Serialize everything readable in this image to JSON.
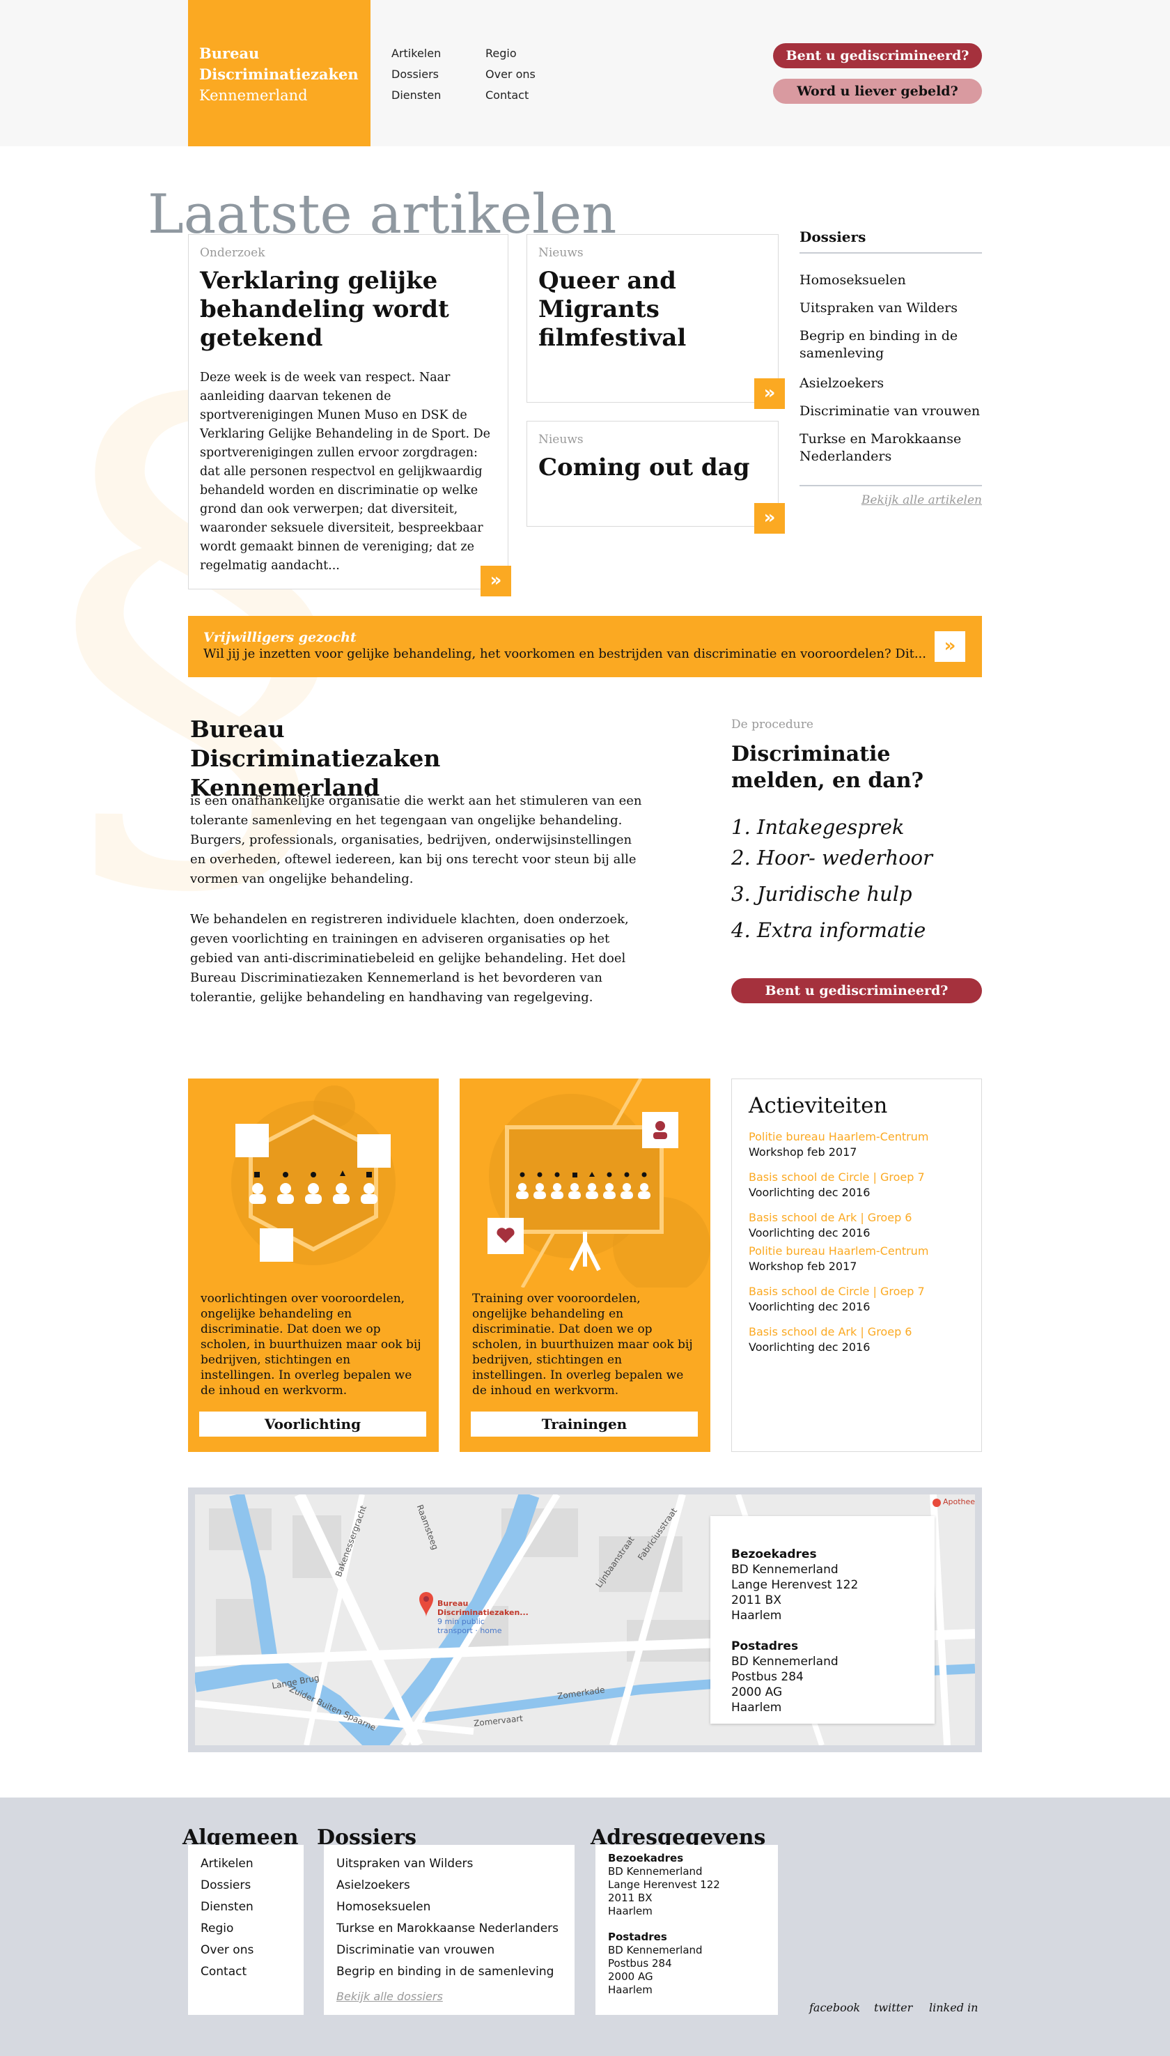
{
  "header": {
    "logo": {
      "line1": "Bureau",
      "line2": "Discriminatiezaken",
      "line3": "Kennemerland"
    },
    "nav_left": [
      "Artikelen",
      "Dossiers",
      "Diensten"
    ],
    "nav_right": [
      "Regio",
      "Over ons",
      "Contact"
    ],
    "cta_primary": "Bent u gediscrimineerd?",
    "cta_secondary": "Word u liever gebeld?"
  },
  "latest": {
    "title": "Laatste artikelen",
    "main_article": {
      "category": "Onderzoek",
      "title": "Verklaring gelijke behandeling wordt getekend",
      "body": "Deze week is de week van respect. Naar aanleiding daarvan tekenen de sportverenigingen Munen Muso en DSK de Verklaring Gelijke Behandeling in de Sport. De sportverenigingen zullen ervoor zorgdragen: dat alle personen respectvol en gelijkwaardig behandeld worden en discriminatie op welke grond dan ook verwerpen; dat diversiteit, waaronder seksuele diversiteit, bespreekbaar wordt gemaakt binnen de vereniging; dat ze regelmatig aandacht..."
    },
    "article2": {
      "category": "Nieuws",
      "title": "Queer and Migrants filmfestival"
    },
    "article3": {
      "category": "Nieuws",
      "title": "Coming out dag"
    },
    "arrow": "»"
  },
  "dossiers": {
    "heading": "Dossiers",
    "items": [
      "Homoseksuelen",
      "Uitspraken van Wilders",
      "Begrip en binding in de samenleving",
      "Asielzoekers",
      "Discriminatie van vrouwen",
      "Turkse en Marokkaanse Nederlanders"
    ],
    "more": "Bekijk alle artikelen"
  },
  "volunteers": {
    "title": "Vrijwilligers gezocht",
    "text": "Wil jij je inzetten voor gelijke behandeling, het voorkomen en bestrijden van discriminatie en vooroordelen? Dit...",
    "arrow": "»"
  },
  "about": {
    "heading": "Bureau Discriminatiezaken Kennemerland",
    "p1": "is een onafhankelijke organisatie die werkt aan het stimuleren van een tolerante samenleving en het tegengaan van ongelijke behandeling. Burgers, professionals, organisaties, bedrijven, onderwijsinstellingen en overheden, oftewel iedereen, kan bij ons terecht voor steun bij alle vormen van ongelijke behandeling.",
    "p2": "We behandelen en registreren individuele klachten, doen onderzoek, geven voorlichting en trainingen en adviseren organisaties op het gebied van anti-discriminatiebeleid en gelijke behandeling. Het doel Bureau Discriminatiezaken Kennemerland is het bevorderen van tolerantie, gelijke behandeling en handhaving van regelgeving."
  },
  "procedure": {
    "category": "De procedure",
    "heading": "Discriminatie melden, en dan?",
    "steps": [
      "1. Intakegesprek",
      "2. Hoor- wederhoor",
      "3. Juridische hulp",
      "4. Extra informatie"
    ],
    "button": "Bent u gediscrimineerd?"
  },
  "services": [
    {
      "text": "voorlichtingen over vooroordelen, ongelijke behandeling en discriminatie. Dat doen we op scholen, in buurthuizen maar ook bij bedrijven, stichtingen en instellingen. In overleg bepalen we de inhoud en werkvorm.",
      "button": "Voorlichting"
    },
    {
      "text": "Training over vooroordelen, ongelijke behandeling en discriminatie. Dat doen we op scholen, in buurthuizen maar ook bij bedrijven, stichtingen en instellingen. In overleg bepalen we de inhoud en werkvorm.",
      "button": "Trainingen"
    }
  ],
  "activities": {
    "heading": "Actieviteiten",
    "items": [
      {
        "location": "Politie bureau Haarlem-Centrum",
        "what": "Workshop feb 2017"
      },
      {
        "location": "Basis school de Circle | Groep 7",
        "what": "Voorlichting dec 2016"
      },
      {
        "location": "Basis school de Ark | Groep 6",
        "what": "Voorlichting dec 2016"
      },
      {
        "location": "Politie bureau Haarlem-Centrum",
        "what": "Workshop feb 2017"
      },
      {
        "location": "Basis school de Circle | Groep 7",
        "what": "Voorlichting dec 2016"
      },
      {
        "location": "Basis school de Ark | Groep 6",
        "what": "Voorlichting dec 2016"
      }
    ]
  },
  "map": {
    "pin_line1": "Bureau",
    "pin_line2": "Discriminatiezaken...",
    "pin_line3": "9 min public",
    "pin_line4": "transport · home",
    "street_labels": [
      "Lange Brug",
      "Zuider Buiten Spaarne",
      "Zomerkade",
      "Zomervaart",
      "Raamsteeg",
      "Fabriciusstraat",
      "Lijnbaanstraat",
      "Apotheek",
      "Bakenessergracht"
    ],
    "bezoek_title": "Bezoekadres",
    "bezoek_lines": [
      "BD Kennemerland",
      "Lange Herenvest 122",
      "2011 BX",
      "Haarlem"
    ],
    "post_title": "Postadres",
    "post_lines": [
      "BD Kennemerland",
      "Postbus 284",
      "2000 AG",
      "Haarlem"
    ]
  },
  "footer": {
    "col1_heading": "Algemeen",
    "col1_items": [
      "Artikelen",
      "Dossiers",
      "Diensten",
      "Regio",
      "Over ons",
      "Contact"
    ],
    "col2_heading": "Dossiers",
    "col2_items": [
      "Uitspraken van Wilders",
      "Asielzoekers",
      "Homoseksuelen",
      "Turkse en Marokkaanse Nederlanders",
      "Discriminatie van vrouwen",
      "Begrip en binding in de samenleving"
    ],
    "col2_more": "Bekijk alle dossiers",
    "col3_heading": "Adresgegevens",
    "bezoek_title": "Bezoekadres",
    "bezoek_lines": [
      "BD Kennemerland",
      "Lange Herenvest 122",
      "2011 BX",
      "Haarlem"
    ],
    "post_title": "Postadres",
    "post_lines": [
      "BD Kennemerland",
      "Postbus 284",
      "2000 AG",
      "Haarlem"
    ],
    "social": [
      "facebook",
      "twitter",
      "linked in"
    ]
  },
  "colors": {
    "accent": "#fba922",
    "primary_button": "#a5313d",
    "secondary_button": "#d99aa0",
    "muted_title": "#8f98a0",
    "footer_bg": "#d6d9e0"
  }
}
